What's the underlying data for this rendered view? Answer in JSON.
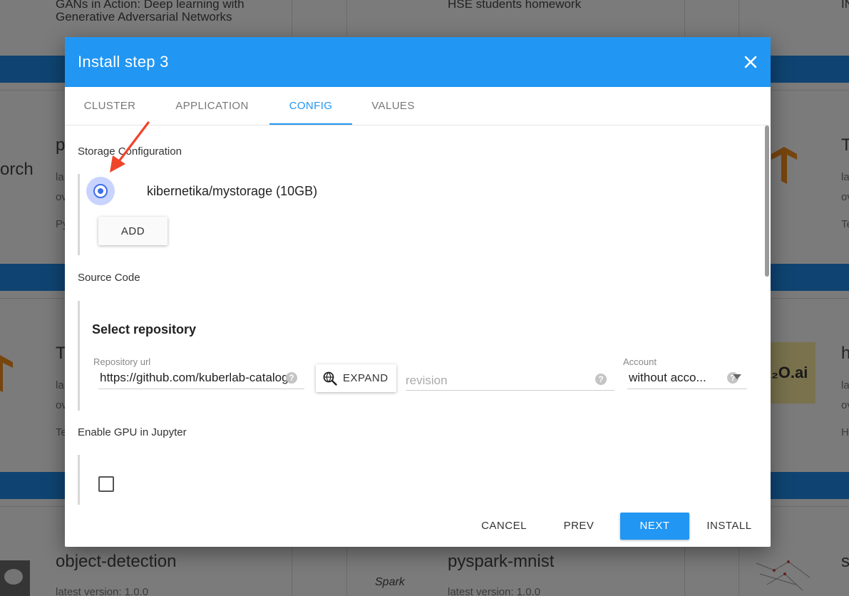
{
  "background": {
    "cards": [
      {
        "title": "GANs in Action: Deep learning with",
        "title2": "Generative Adversarial Networks"
      },
      {
        "title": "HSE students homework"
      },
      {
        "title": "IN"
      },
      {
        "title": "orch"
      },
      {
        "title": "p"
      },
      {
        "title": "la"
      },
      {
        "title": "ov"
      },
      {
        "title": "Py"
      },
      {
        "title": "T"
      },
      {
        "title": "la"
      },
      {
        "title": "ov"
      },
      {
        "title": "Te"
      },
      {
        "title": "T"
      },
      {
        "title": "la"
      },
      {
        "title": "ov"
      },
      {
        "title": "Te"
      },
      {
        "title": "h"
      },
      {
        "title": "la"
      },
      {
        "title": "ov"
      },
      {
        "title": "H"
      },
      {
        "title": "object-detection",
        "version": "latest version: 1.0.0"
      },
      {
        "title": "pyspark-mnist",
        "version": "latest version: 1.0.0"
      },
      {
        "title": "s"
      }
    ],
    "h2o_label": "₂O.ai",
    "spark_label": "Spark"
  },
  "dialog": {
    "title": "Install step 3",
    "tabs": [
      {
        "label": "CLUSTER",
        "active": false
      },
      {
        "label": "APPLICATION",
        "active": false
      },
      {
        "label": "CONFIG",
        "active": true
      },
      {
        "label": "VALUES",
        "active": false
      }
    ],
    "storage": {
      "section_label": "Storage Configuration",
      "option_label": "kibernetika/mystorage (10GB)",
      "selected": true,
      "add_label": "ADD"
    },
    "source": {
      "section_label": "Source Code",
      "heading": "Select repository",
      "repo_label": "Repository url",
      "repo_value": "https://github.com/kuberlab-catalog",
      "expand_label": "EXPAND",
      "revision_placeholder": "revision",
      "account_label": "Account",
      "account_value": "without acco..."
    },
    "gpu": {
      "section_label": "Enable GPU in Jupyter",
      "checked": false
    },
    "footer": {
      "cancel": "CANCEL",
      "prev": "PREV",
      "next": "NEXT",
      "install": "INSTALL"
    }
  },
  "colors": {
    "primary": "#2196f3",
    "radio": "#3f6ee8",
    "annotation_arrow": "#f0442a"
  }
}
